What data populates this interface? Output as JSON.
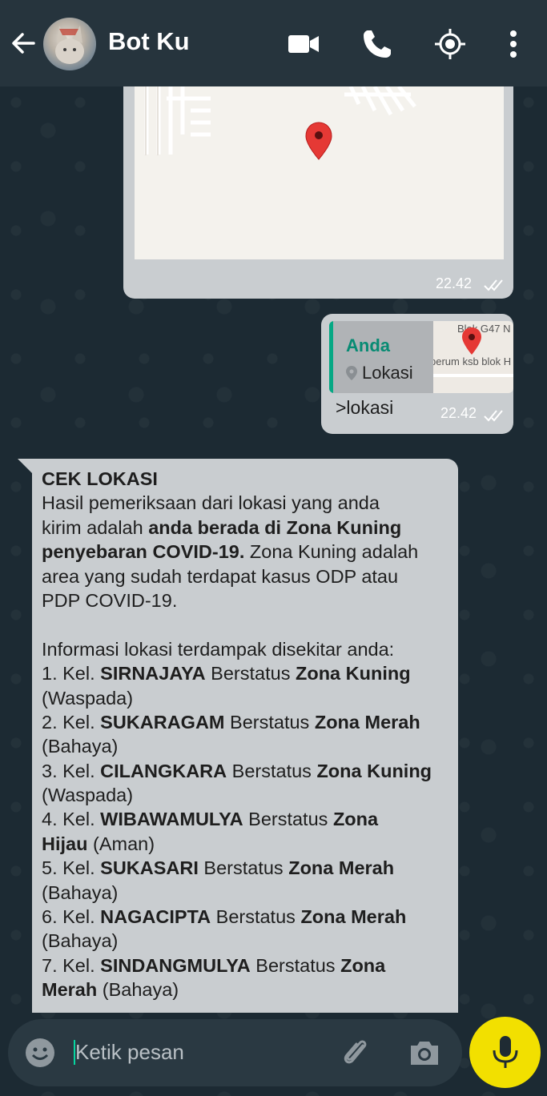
{
  "header": {
    "title": "Bot Ku",
    "icons": [
      "back-arrow-icon",
      "video-call-icon",
      "phone-icon",
      "location-icon",
      "more-vert-icon"
    ]
  },
  "map_message": {
    "time": "22.42",
    "status": "read"
  },
  "reply_message": {
    "quote_name": "Anda",
    "quote_label": "Lokasi",
    "thumb_text_1": "Blok G47 N",
    "thumb_text_2": "perum ksb blok H",
    "text": ">lokasi",
    "time": "22.42"
  },
  "bot_message": {
    "heading": "CEK LOKASI",
    "intro_1": "Hasil pemeriksaan dari lokasi yang anda",
    "intro_2a": "kirim adalah ",
    "intro_2b": "anda berada di Zona Kuning",
    "intro_3a": "penyebaran COVID-19.",
    "intro_3b": " Zona Kuning adalah",
    "intro_4": "area yang sudah terdapat kasus ODP atau",
    "intro_5": "PDP COVID-19.",
    "info_heading": "Informasi lokasi terdampak disekitar anda:",
    "items": [
      {
        "num": "1. Kel. ",
        "kel": "SIRNAJAYA",
        "mid": " Berstatus ",
        "zone": "Zona Kuning",
        "zone2": "",
        "status": "(Waspada)"
      },
      {
        "num": "2. Kel. ",
        "kel": "SUKARAGAM",
        "mid": " Berstatus ",
        "zone": "Zona Merah",
        "zone2": "",
        "status": "(Bahaya)"
      },
      {
        "num": "3. Kel. ",
        "kel": "CILANGKARA",
        "mid": " Berstatus ",
        "zone": "Zona Kuning",
        "zone2": "",
        "status": "(Waspada)"
      },
      {
        "num": "4. Kel. ",
        "kel": "WIBAWAMULYA",
        "mid": " Berstatus ",
        "zone": "Zona",
        "zone2": "Hijau",
        "status": " (Aman)"
      },
      {
        "num": "5. Kel. ",
        "kel": "SUKASARI",
        "mid": " Berstatus ",
        "zone": "Zona Merah",
        "zone2": "",
        "status": "(Bahaya)"
      },
      {
        "num": "6. Kel. ",
        "kel": "NAGACIPTA",
        "mid": " Berstatus ",
        "zone": "Zona Merah",
        "zone2": "",
        "status": "(Bahaya)"
      },
      {
        "num": "7. Kel. ",
        "kel": "SINDANGMULYA",
        "mid": " Berstatus ",
        "zone": "Zona",
        "zone2": "Merah",
        "status": " (Bahaya)"
      }
    ]
  },
  "input": {
    "placeholder": "Ketik pesan"
  },
  "colors": {
    "header_bg": "#26343d",
    "bubble_bg": "#c9cdd0",
    "accent_green": "#06a884",
    "mic_yellow": "#f2e000"
  }
}
